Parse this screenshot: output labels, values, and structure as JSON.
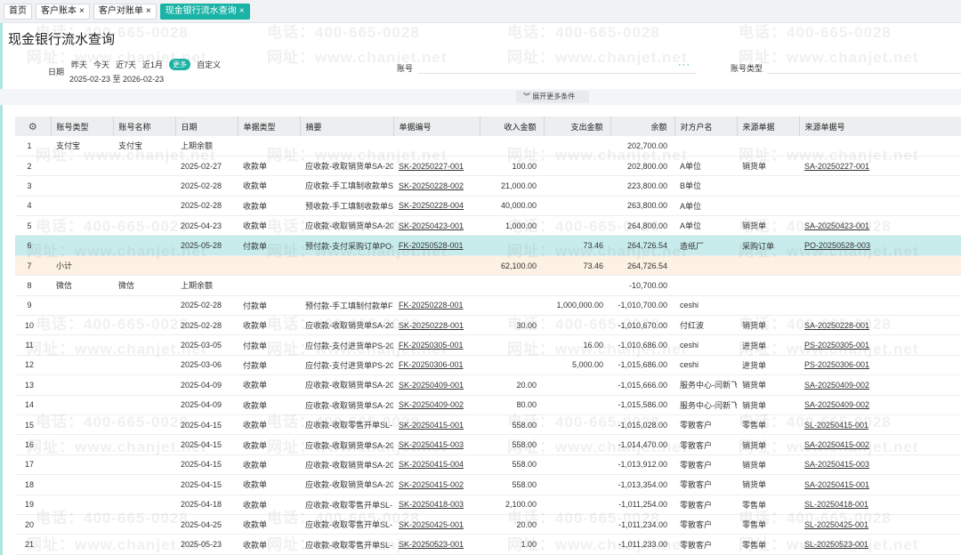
{
  "tabs": [
    {
      "label": "首页",
      "closable": false,
      "active": false
    },
    {
      "label": "客户账本",
      "closable": true,
      "active": false
    },
    {
      "label": "客户对账单",
      "closable": true,
      "active": false
    },
    {
      "label": "现金银行流水查询",
      "closable": true,
      "active": true
    }
  ],
  "close_glyph": "×",
  "page_title": "现金银行流水查询",
  "filter": {
    "date_label": "日期",
    "quick_dates": [
      "昨天",
      "今天",
      "近7天",
      "近1月",
      "更多",
      "自定义"
    ],
    "date_range": "2025-02-23 至 2026-02-23",
    "account_label": "账号",
    "account_picker": "···",
    "account_type_label": "账号类型",
    "expand_label": "展开更多条件"
  },
  "watermark": {
    "phone": "电话：400-665-0028",
    "site": "网址：www.chanjet.net"
  },
  "table": {
    "settings_icon": "⚙",
    "headers": [
      "账号类型",
      "账号名称",
      "日期",
      "单据类型",
      "摘要",
      "单据编号",
      "收入金额",
      "支出金额",
      "余额",
      "对方户名",
      "来源单据",
      "来源单据号"
    ],
    "rows": [
      {
        "no": "1",
        "account_type": "支付宝",
        "account_name": "支付宝",
        "date": "上期余额",
        "doc_type": "",
        "summary": "",
        "doc_no": "",
        "income": "",
        "expense": "",
        "balance": "202,700.00",
        "party": "",
        "source": "",
        "source_no": ""
      },
      {
        "no": "2",
        "account_type": "",
        "account_name": "",
        "date": "2025-02-27",
        "doc_type": "收款单",
        "summary": "应收款-收取销货单SA-20",
        "doc_no": "SK-20250227-001",
        "income": "100.00",
        "expense": "",
        "balance": "202,800.00",
        "party": "A单位",
        "source": "销货单",
        "source_no": "SA-20250227-001"
      },
      {
        "no": "3",
        "account_type": "",
        "account_name": "",
        "date": "2025-02-28",
        "doc_type": "收款单",
        "summary": "应收款-手工填制收款单S",
        "doc_no": "SK-20250228-002",
        "income": "21,000.00",
        "expense": "",
        "balance": "223,800.00",
        "party": "B单位",
        "source": "",
        "source_no": ""
      },
      {
        "no": "4",
        "account_type": "",
        "account_name": "",
        "date": "2025-02-28",
        "doc_type": "收款单",
        "summary": "预收款-手工填制收款单S",
        "doc_no": "SK-20250228-004",
        "income": "40,000.00",
        "expense": "",
        "balance": "263,800.00",
        "party": "A单位",
        "source": "",
        "source_no": ""
      },
      {
        "no": "5",
        "account_type": "",
        "account_name": "",
        "date": "2025-04-23",
        "doc_type": "收款单",
        "summary": "应收款-收取销货单SA-20",
        "doc_no": "SK-20250423-001",
        "income": "1,000.00",
        "expense": "",
        "balance": "264,800.00",
        "party": "A单位",
        "source": "销货单",
        "source_no": "SA-20250423-001"
      },
      {
        "no": "6",
        "account_type": "",
        "account_name": "",
        "date": "2025-05-28",
        "doc_type": "付款单",
        "summary": "预付款-支付采购订单PO-",
        "doc_no": "FK-20250528-001",
        "income": "",
        "expense": "73.46",
        "balance": "264,726.54",
        "party": "造纸厂",
        "source": "采购订单",
        "source_no": "PO-20250528-003",
        "selected": true
      },
      {
        "no": "7",
        "account_type": "小计",
        "account_name": "",
        "date": "",
        "doc_type": "",
        "summary": "",
        "doc_no": "",
        "income": "62,100.00",
        "expense": "73.46",
        "balance": "264,726.54",
        "party": "",
        "source": "",
        "source_no": "",
        "subtotal": true
      },
      {
        "no": "8",
        "account_type": "微信",
        "account_name": "微信",
        "date": "上期余额",
        "doc_type": "",
        "summary": "",
        "doc_no": "",
        "income": "",
        "expense": "",
        "balance": "-10,700.00",
        "party": "",
        "source": "",
        "source_no": ""
      },
      {
        "no": "9",
        "account_type": "",
        "account_name": "",
        "date": "2025-02-28",
        "doc_type": "付款单",
        "summary": "预付款-手工填制付款单F",
        "doc_no": "FK-20250228-001",
        "income": "",
        "expense": "1,000,000.00",
        "balance": "-1,010,700.00",
        "party": "ceshi",
        "source": "",
        "source_no": ""
      },
      {
        "no": "10",
        "account_type": "",
        "account_name": "",
        "date": "2025-02-28",
        "doc_type": "收款单",
        "summary": "应收款-收取销货单SA-20",
        "doc_no": "SK-20250228-001",
        "income": "30.00",
        "expense": "",
        "balance": "-1,010,670.00",
        "party": "付红波",
        "source": "销货单",
        "source_no": "SA-20250228-001"
      },
      {
        "no": "11",
        "account_type": "",
        "account_name": "",
        "date": "2025-03-05",
        "doc_type": "付款单",
        "summary": "应付款-支付进货单PS-20",
        "doc_no": "FK-20250305-001",
        "income": "",
        "expense": "16.00",
        "balance": "-1,010,686.00",
        "party": "ceshi",
        "source": "进货单",
        "source_no": "PS-20250305-001"
      },
      {
        "no": "12",
        "account_type": "",
        "account_name": "",
        "date": "2025-03-06",
        "doc_type": "付款单",
        "summary": "应付款-支付进货单PS-20",
        "doc_no": "FK-20250306-001",
        "income": "",
        "expense": "5,000.00",
        "balance": "-1,015,686.00",
        "party": "ceshi",
        "source": "进货单",
        "source_no": "PS-20250306-001"
      },
      {
        "no": "13",
        "account_type": "",
        "account_name": "",
        "date": "2025-04-09",
        "doc_type": "收款单",
        "summary": "应收款-收取销货单SA-20",
        "doc_no": "SK-20250409-001",
        "income": "20.00",
        "expense": "",
        "balance": "-1,015,666.00",
        "party": "服务中心-闫新飞",
        "source": "销货单",
        "source_no": "SA-20250409-002"
      },
      {
        "no": "14",
        "account_type": "",
        "account_name": "",
        "date": "2025-04-09",
        "doc_type": "收款单",
        "summary": "应收款-收取销货单SA-20",
        "doc_no": "SK-20250409-002",
        "income": "80.00",
        "expense": "",
        "balance": "-1,015,586.00",
        "party": "服务中心-闫新飞",
        "source": "销货单",
        "source_no": "SA-20250409-002"
      },
      {
        "no": "15",
        "account_type": "",
        "account_name": "",
        "date": "2025-04-15",
        "doc_type": "收款单",
        "summary": "应收款-收取零售开单SL-",
        "doc_no": "SK-20250415-001",
        "income": "558.00",
        "expense": "",
        "balance": "-1,015,028.00",
        "party": "零散客户",
        "source": "零售单",
        "source_no": "SL-20250415-001"
      },
      {
        "no": "16",
        "account_type": "",
        "account_name": "",
        "date": "2025-04-15",
        "doc_type": "收款单",
        "summary": "应收款-收取销货单SA-20",
        "doc_no": "SK-20250415-003",
        "income": "558.00",
        "expense": "",
        "balance": "-1,014,470.00",
        "party": "零散客户",
        "source": "销货单",
        "source_no": "SA-20250415-002"
      },
      {
        "no": "17",
        "account_type": "",
        "account_name": "",
        "date": "2025-04-15",
        "doc_type": "收款单",
        "summary": "应收款-收取销货单SA-20",
        "doc_no": "SK-20250415-004",
        "income": "558.00",
        "expense": "",
        "balance": "-1,013,912.00",
        "party": "零散客户",
        "source": "销货单",
        "source_no": "SA-20250415-003"
      },
      {
        "no": "18",
        "account_type": "",
        "account_name": "",
        "date": "2025-04-15",
        "doc_type": "收款单",
        "summary": "应收款-收取销货单SA-20",
        "doc_no": "SK-20250415-002",
        "income": "558.00",
        "expense": "",
        "balance": "-1,013,354.00",
        "party": "零散客户",
        "source": "销货单",
        "source_no": "SA-20250415-001"
      },
      {
        "no": "19",
        "account_type": "",
        "account_name": "",
        "date": "2025-04-18",
        "doc_type": "收款单",
        "summary": "应收款-收取零售开单SL-",
        "doc_no": "SK-20250418-003",
        "income": "2,100.00",
        "expense": "",
        "balance": "-1,011,254.00",
        "party": "零散客户",
        "source": "零售单",
        "source_no": "SL-20250418-001"
      },
      {
        "no": "20",
        "account_type": "",
        "account_name": "",
        "date": "2025-04-25",
        "doc_type": "收款单",
        "summary": "应收款-收取零售开单SL-",
        "doc_no": "SK-20250425-001",
        "income": "20.00",
        "expense": "",
        "balance": "-1,011,234.00",
        "party": "零散客户",
        "source": "零售单",
        "source_no": "SL-20250425-001"
      },
      {
        "no": "21",
        "account_type": "",
        "account_name": "",
        "date": "2025-05-23",
        "doc_type": "收款单",
        "summary": "应收款-收取零售开单SL-",
        "doc_no": "SK-20250523-001",
        "income": "1.00",
        "expense": "",
        "balance": "-1,011,233.00",
        "party": "零散客户",
        "source": "零售单",
        "source_no": "SL-20250523-001"
      }
    ]
  }
}
